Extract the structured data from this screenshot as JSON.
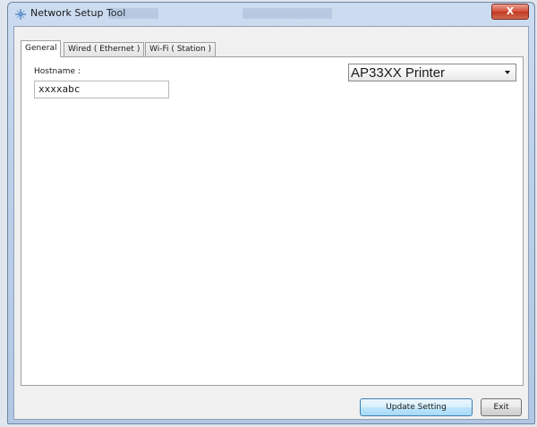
{
  "window": {
    "title": "Network Setup Tool",
    "close_label": "X"
  },
  "tabs": [
    {
      "label": "General"
    },
    {
      "label": "Wired ( Ethernet )"
    },
    {
      "label": "Wi-Fi ( Station )"
    }
  ],
  "general": {
    "hostname_label": "Hostname :",
    "hostname_value": "xxxxabc",
    "model_selected": "AP33XX Printer"
  },
  "footer": {
    "update_label": "Update Setting",
    "exit_label": "Exit"
  },
  "icons": {
    "app": "network-icon",
    "dropdown": "chevron-down-icon",
    "close": "close-icon"
  },
  "colors": {
    "title_bar": "#c5d6ec",
    "close_button": "#c9452e",
    "primary_button": "#bee6fd"
  }
}
